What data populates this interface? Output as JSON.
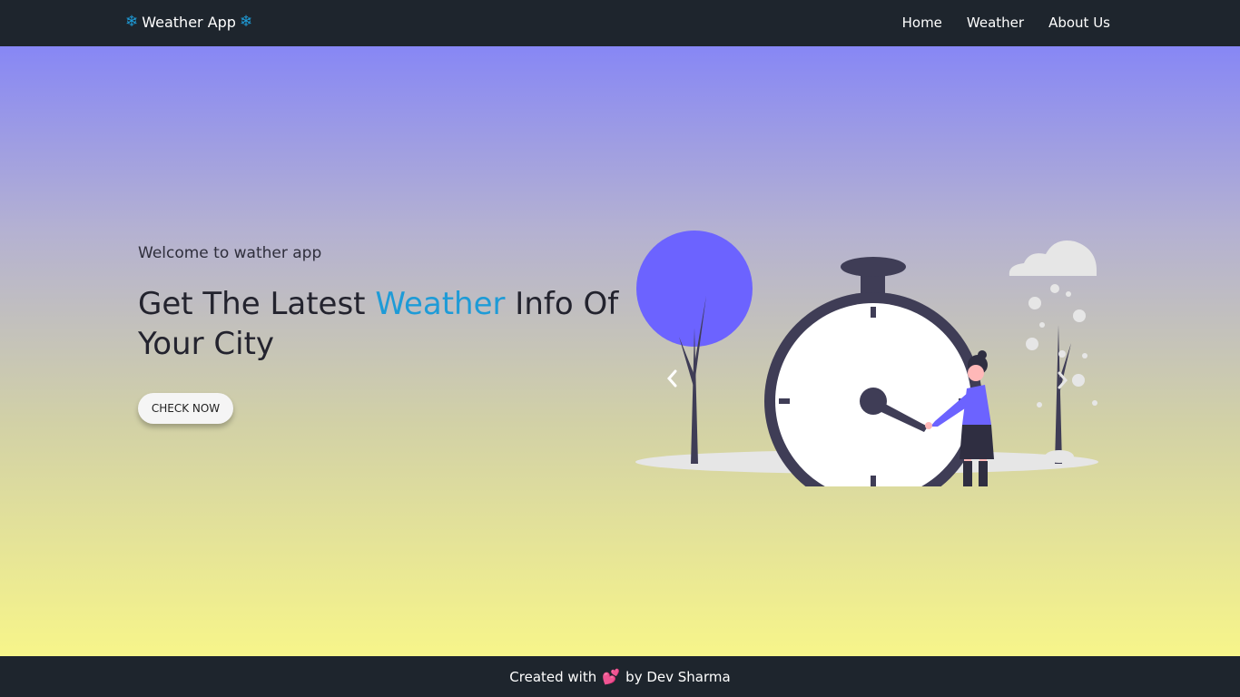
{
  "nav": {
    "brand": {
      "icon_left": "snowflake-icon",
      "label": "Weather App",
      "icon_right": "snowflake-icon"
    },
    "links": [
      {
        "label": "Home"
      },
      {
        "label": "Weather"
      },
      {
        "label": "About Us"
      }
    ]
  },
  "hero": {
    "welcome": "Welcome to wather app",
    "headline": {
      "part1": "Get The Latest ",
      "accent": "Weather",
      "part2": " Info Of Your City"
    },
    "button_label": "CHECK NOW",
    "carousel": {
      "prev_icon": "chevron-left-icon",
      "next_icon": "chevron-right-icon"
    }
  },
  "footer": {
    "text_before": "Created with",
    "icon": "heart-icon",
    "text_after": "by Dev Sharma"
  },
  "colors": {
    "navbar_bg": "#1e252d",
    "accent": "#1e9bd7",
    "gradient_top": "#8787f5",
    "gradient_bottom": "#f7f58a",
    "illustration_purple": "#6c63ff",
    "illustration_dark": "#3f3d56",
    "illustration_pink": "#ff6584"
  }
}
